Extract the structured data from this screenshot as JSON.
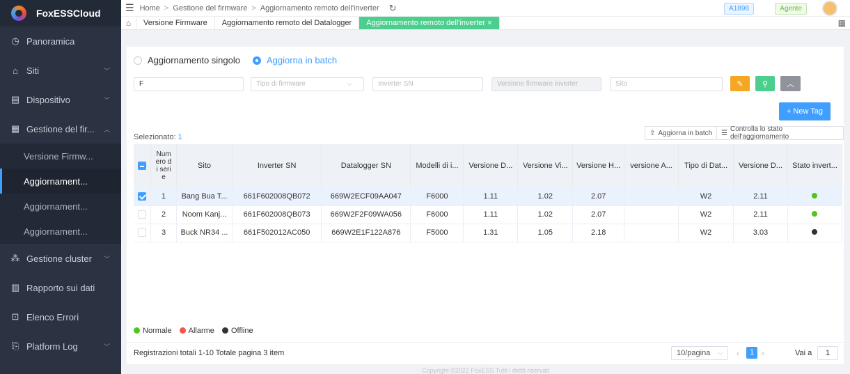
{
  "app": {
    "name": "FoxESSCloud"
  },
  "sidebar": {
    "items": [
      {
        "label": "Panoramica",
        "icon": "dashboard-icon",
        "glyph": "◷",
        "has_chevron": false
      },
      {
        "label": "Siti",
        "icon": "home-icon",
        "glyph": "⌂",
        "has_chevron": true
      },
      {
        "label": "Dispositivo",
        "icon": "device-icon",
        "glyph": "▤",
        "has_chevron": true
      },
      {
        "label": "Gestione del fir...",
        "icon": "firmware-icon",
        "glyph": "▦",
        "has_chevron": true
      }
    ],
    "sub_items": [
      {
        "label": "Versione Firmw...",
        "active": false
      },
      {
        "label": "Aggiornament...",
        "active": true
      },
      {
        "label": "Aggiornament...",
        "active": false
      },
      {
        "label": "Aggiornament...",
        "active": false
      }
    ],
    "items_bottom": [
      {
        "label": "Gestione cluster",
        "icon": "cluster-icon",
        "glyph": "⁂",
        "has_chevron": true
      },
      {
        "label": "Rapporto sui dati",
        "icon": "chart-icon",
        "glyph": "▥",
        "has_chevron": false
      },
      {
        "label": "Elenco Errori",
        "icon": "error-list-icon",
        "glyph": "⊡",
        "has_chevron": false
      },
      {
        "label": "Platform Log",
        "icon": "log-icon",
        "glyph": "⎘",
        "has_chevron": true
      }
    ]
  },
  "header": {
    "breadcrumb": [
      "Home",
      "Gestione del firmware",
      "Aggiornamento remoto dell'inverter"
    ],
    "user_code": "A1898",
    "role": "Agente"
  },
  "tabs": [
    {
      "label": "Versione Firmware",
      "active": false
    },
    {
      "label": "Aggiornamento remoto del Datalogger",
      "active": false
    },
    {
      "label": "Aggiornamento remoto dell'inverter ×",
      "active": true
    }
  ],
  "mode": {
    "single": "Aggiornamento singolo",
    "batch": "Aggiorna in batch"
  },
  "filters": {
    "first_value": "F",
    "firmware_type_placeholder": "Tipo di firmware",
    "inverter_sn_placeholder": "Inverter SN",
    "inverter_version_placeholder": "Versione firmware inverter",
    "site_placeholder": "Sito"
  },
  "actions": {
    "new_tag": "+ New Tag",
    "batch_update": "Aggiorna in batch",
    "check_status": "Controlla lo stato dell'aggiornamento"
  },
  "selection": {
    "label": "Selezionato:",
    "count": "1"
  },
  "table": {
    "columns": [
      "Numero di serie",
      "Sito",
      "Inverter SN",
      "Datalogger SN",
      "Modelli di i...",
      "Versione D...",
      "Versione Vi...",
      "Versione H...",
      "versione A...",
      "Tipo di Dat...",
      "Versione D...",
      "Stato invert..."
    ],
    "rows": [
      {
        "n": "1",
        "site": "Bang Bua T...",
        "inv": "661F602008QB072",
        "dl": "669W2ECF09AA047",
        "model": "F6000",
        "v1": "1.11",
        "v2": "1.02",
        "v3": "2.07",
        "v4": "",
        "type": "W2",
        "v5": "2.11",
        "status": "normal",
        "checked": true
      },
      {
        "n": "2",
        "site": "Noom Kanj...",
        "inv": "661F602008QB073",
        "dl": "669W2F2F09WA056",
        "model": "F6000",
        "v1": "1.11",
        "v2": "1.02",
        "v3": "2.07",
        "v4": "",
        "type": "W2",
        "v5": "2.11",
        "status": "normal",
        "checked": false
      },
      {
        "n": "3",
        "site": "Buck NR34 ...",
        "inv": "661F502012AC050",
        "dl": "669W2E1F122A876",
        "model": "F5000",
        "v1": "1.31",
        "v2": "1.05",
        "v3": "2.18",
        "v4": "",
        "type": "W2",
        "v5": "3.03",
        "status": "offline",
        "checked": false
      }
    ]
  },
  "legend": {
    "normal": "Normale",
    "alarm": "Allarme",
    "offline": "Offline"
  },
  "colors": {
    "normal": "#52c41a",
    "alarm": "#f5554f",
    "offline": "#333333",
    "accent": "#409eff",
    "green": "#4ccf8e",
    "orange": "#f5a623"
  },
  "pagination": {
    "summary": "Registrazioni totali 1-10 Totale pagina 3 item",
    "page_size": "10/pagina",
    "current_page": "1",
    "goto_label": "Vai a",
    "goto_value": "1"
  },
  "footer": "Copyright ©2022 FoxESS Tutti i diritti riservati"
}
